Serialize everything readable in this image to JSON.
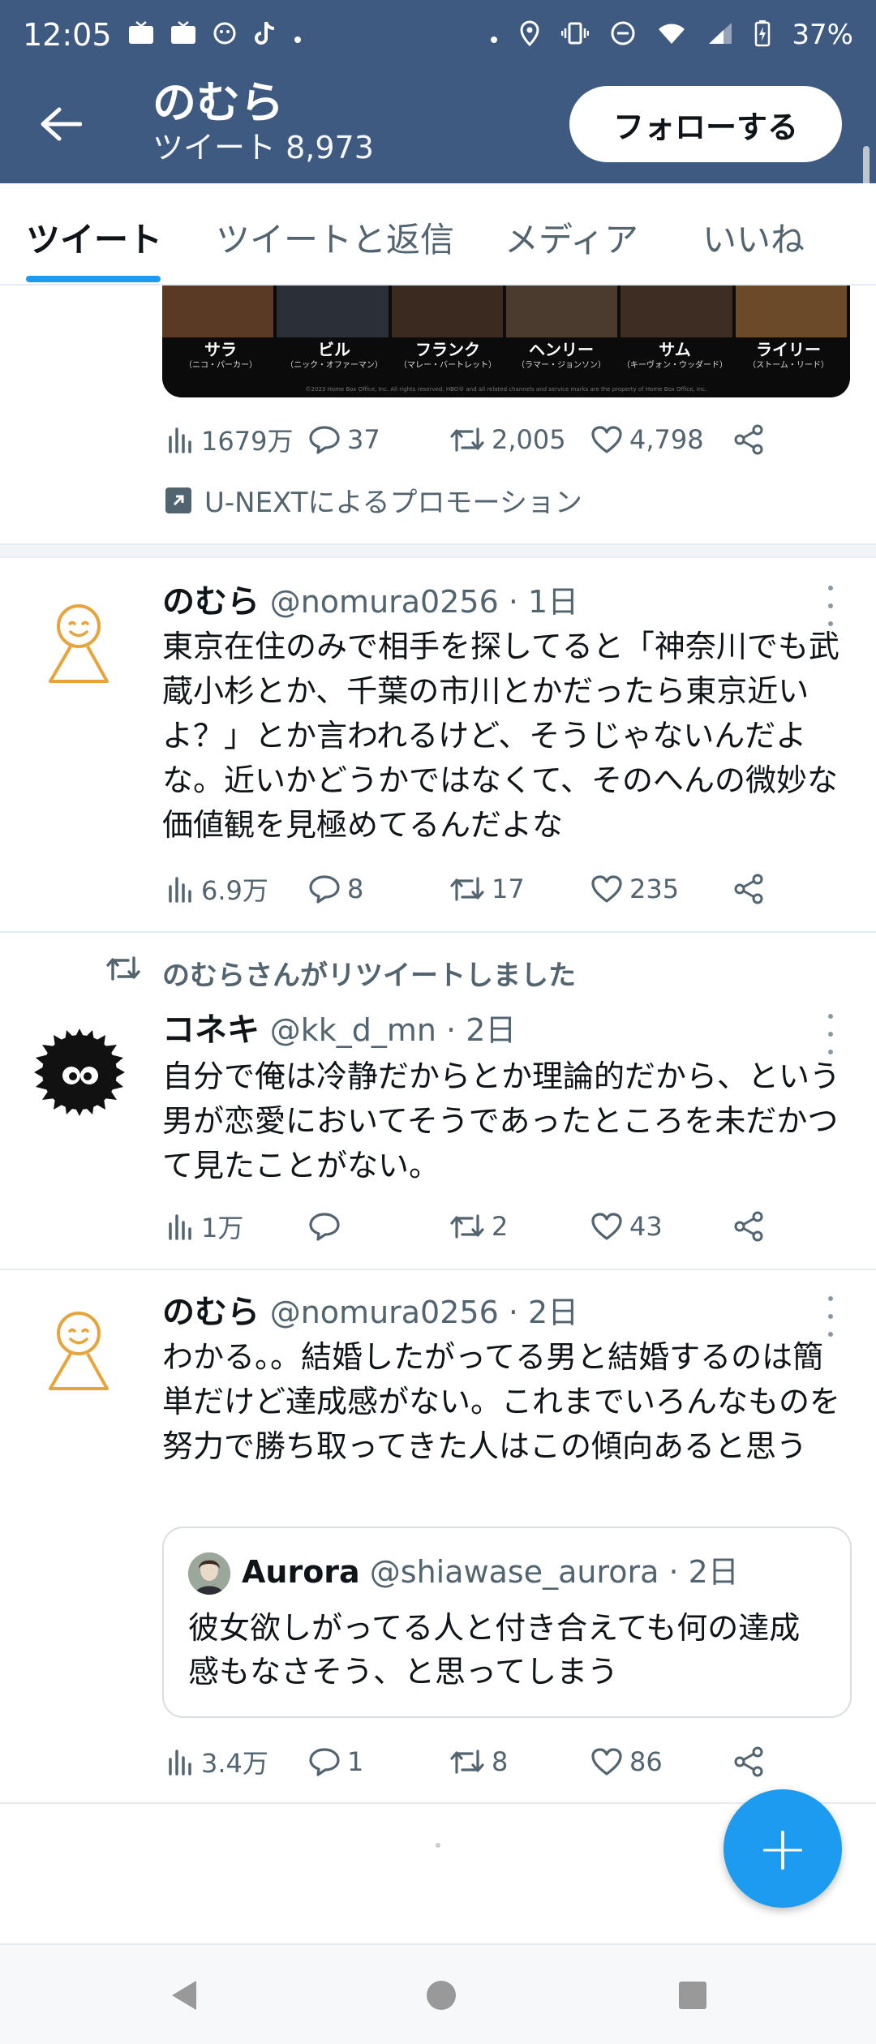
{
  "status_bar": {
    "time": "12:05",
    "battery": "37%",
    "icons": [
      "tv-icon",
      "tv-icon",
      "face-icon",
      "tiktok-icon",
      "dot-icon",
      "dot-icon",
      "location-icon",
      "vibrate-icon",
      "dnd-icon",
      "wifi-icon",
      "signal-icon",
      "battery-icon"
    ]
  },
  "header": {
    "name": "のむら",
    "subtitle": "ツイート 8,973",
    "follow_label": "フォローする",
    "colors": {
      "bar": "#3e5a80",
      "accent": "#1d9bf0"
    }
  },
  "tabs": [
    {
      "label": "ツイート",
      "active": true
    },
    {
      "label": "ツイートと返信",
      "active": false
    },
    {
      "label": "メディア",
      "active": false
    },
    {
      "label": "いいね",
      "active": false
    }
  ],
  "promo": {
    "cast": [
      {
        "name": "サラ",
        "role": "（ニコ・パーカー）"
      },
      {
        "name": "ビル",
        "role": "（ニック・オファーマン）"
      },
      {
        "name": "フランク",
        "role": "（マレー・バートレット）"
      },
      {
        "name": "ヘンリー",
        "role": "（ラマー・ジョンソン）"
      },
      {
        "name": "サム",
        "role": "（キーヴォン・ウッダード）"
      },
      {
        "name": "ライリー",
        "role": "（ストーム・リード）"
      }
    ],
    "fine_print": "©2023 Home Box Office, Inc. All rights reserved. HBO® and all related channels and service marks are the property of Home Box Office, Inc.",
    "stats": {
      "views": "1679万",
      "replies": "37",
      "retweets": "2,005",
      "likes": "4,798"
    },
    "label": "U-NEXTによるプロモーション"
  },
  "tweets": [
    {
      "name": "のむら",
      "handle": "@nomura0256",
      "time": "1日",
      "text": "東京在住のみで相手を探してると「神奈川でも武蔵小杉とか、千葉の市川とかだったら東京近いよ？」とか言われるけど、そうじゃないんだよな。近いかどうかではなくて、そのへんの微妙な価値観を見極めてるんだよな",
      "stats": {
        "views": "6.9万",
        "replies": "8",
        "retweets": "17",
        "likes": "235"
      }
    },
    {
      "retweeted_by": "のむらさんがリツイートしました",
      "name": "コネキ",
      "handle": "@kk_d_mn",
      "time": "2日",
      "text": "自分で俺は冷静だからとか理論的だから、という男が恋愛においてそうであったところを未だかつて見たことがない。",
      "stats": {
        "views": "1万",
        "replies": "",
        "retweets": "2",
        "likes": "43"
      }
    },
    {
      "name": "のむら",
      "handle": "@nomura0256",
      "time": "2日",
      "text": "わかる。。結婚したがってる男と結婚するのは簡単だけど達成感がない。これまでいろんなものを努力で勝ち取ってきた人はこの傾向あると思う",
      "quote": {
        "name": "Aurora",
        "handle": "@shiawase_aurora",
        "time": "2日",
        "text": "彼女欲しがってる人と付き合えても何の達成感もなさそう、と思ってしまう"
      },
      "stats": {
        "views": "3.4万",
        "replies": "1",
        "retweets": "8",
        "likes": "86"
      }
    }
  ],
  "separator": " · ",
  "fab_label": "+",
  "nav_bar": [
    "back-icon",
    "home-icon",
    "recents-icon"
  ]
}
